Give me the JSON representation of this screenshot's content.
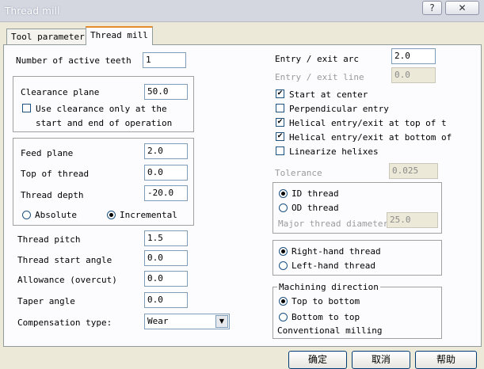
{
  "window": {
    "title": "Thread mill",
    "help_glyph": "?",
    "close_glyph": "✕"
  },
  "tabs": [
    {
      "label": "Tool parameters"
    },
    {
      "label": "Thread mill"
    }
  ],
  "left": {
    "active_teeth": {
      "label": "Number of active teeth",
      "value": "1"
    },
    "clearance": {
      "label": "Clearance plane",
      "value": "50.0",
      "check_line1": "Use clearance only at the",
      "check_line2": "start and end of operation",
      "checked": false
    },
    "feed_plane": {
      "label": "Feed plane",
      "value": "2.0"
    },
    "top_of_thread": {
      "label": "Top of thread",
      "value": "0.0"
    },
    "thread_depth": {
      "label": "Thread depth",
      "value": "-20.0"
    },
    "absolute": {
      "label": "Absolute",
      "selected": false
    },
    "incremental": {
      "label": "Incremental",
      "selected": true
    },
    "thread_pitch": {
      "label": "Thread pitch",
      "value": "1.5"
    },
    "thread_start_angle": {
      "label": "Thread start angle",
      "value": "0.0"
    },
    "allowance": {
      "label": "Allowance (overcut)",
      "value": "0.0"
    },
    "taper_angle": {
      "label": "Taper angle",
      "value": "0.0"
    },
    "compensation": {
      "label": "Compensation type:",
      "value": "Wear"
    }
  },
  "right": {
    "entry_exit_arc": {
      "label": "Entry / exit arc",
      "value": "2.0"
    },
    "entry_exit_line": {
      "label": "Entry / exit line",
      "value": "0.0"
    },
    "checks": [
      {
        "label": "Start at center",
        "checked": true
      },
      {
        "label": "Perpendicular entry",
        "checked": false
      },
      {
        "label": "Helical entry/exit at top of t",
        "checked": true
      },
      {
        "label": "Helical entry/exit at bottom of",
        "checked": true
      },
      {
        "label": "Linearize helixes",
        "checked": false
      }
    ],
    "tolerance": {
      "label": "Tolerance",
      "value": "0.025"
    },
    "id_thread": {
      "label": "ID thread",
      "selected": true
    },
    "od_thread": {
      "label": "OD thread",
      "selected": false
    },
    "major_diameter": {
      "label": "Major thread diameter",
      "value": "25.0"
    },
    "right_hand": {
      "label": "Right-hand thread",
      "selected": true
    },
    "left_hand": {
      "label": "Left-hand thread",
      "selected": false
    },
    "machining": {
      "title": "Machining direction",
      "top_to_bottom": {
        "label": "Top to bottom",
        "selected": true
      },
      "bottom_to_top": {
        "label": "Bottom to top",
        "selected": false
      },
      "status": "Conventional milling"
    }
  },
  "buttons": {
    "ok": "确定",
    "cancel": "取消",
    "help": "帮助"
  }
}
